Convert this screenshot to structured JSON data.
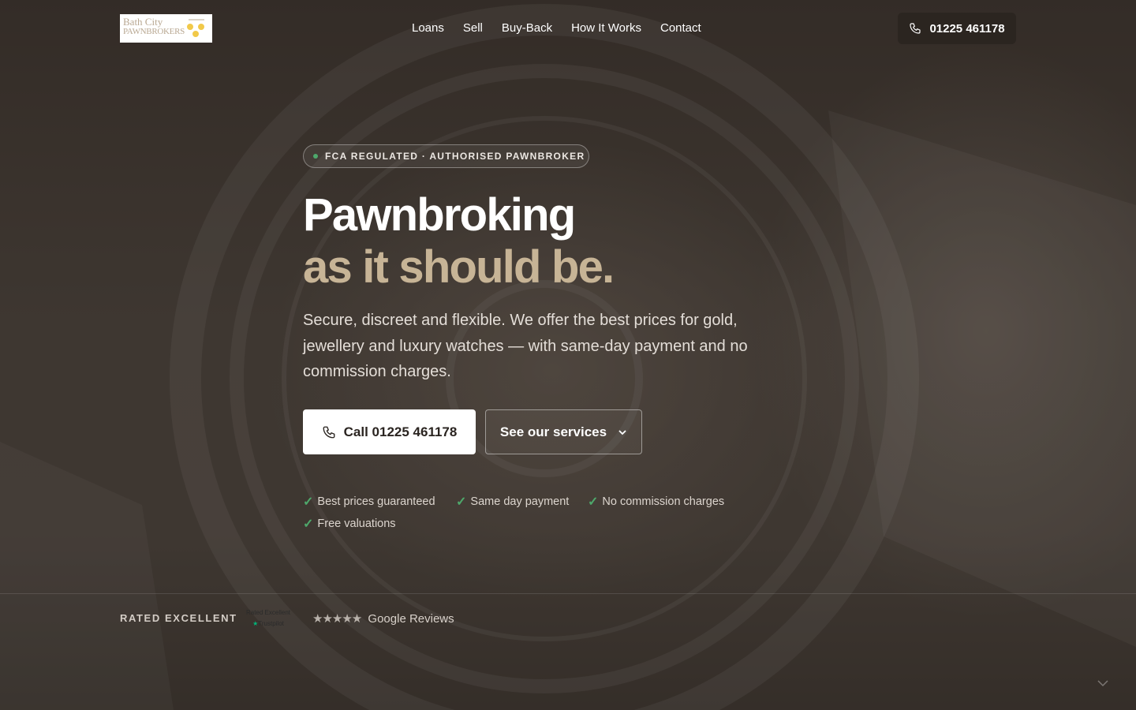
{
  "header": {
    "logo": {
      "line1": "Bath City",
      "line2": "PAWNBROKERS"
    },
    "nav": [
      "Loans",
      "Sell",
      "Buy-Back",
      "How It Works",
      "Contact"
    ],
    "phone": "01225 461178"
  },
  "hero": {
    "badge": "FCA REGULATED · AUTHORISED PAWNBROKER",
    "title_line1": "Pawnbroking",
    "title_line2": "as it should be.",
    "description": "Secure, discreet and flexible. We offer the best prices for gold, jewellery and luxury watches — with same-day payment and no commission charges.",
    "cta_primary": "Call 01225 461178",
    "cta_secondary": "See our services",
    "features": [
      "Best prices guaranteed",
      "Same day payment",
      "No commission charges",
      "Free valuations"
    ]
  },
  "rating": {
    "label": "RATED EXCELLENT",
    "trustpilot_line1": "Rated Excellent",
    "trustpilot_line2": "Trustpilot",
    "stars": "★★★★★",
    "google": "Google Reviews"
  },
  "colors": {
    "accent_gold": "#c7b496",
    "check_green": "#4ea86b",
    "header_button_bg": "#2b2520"
  },
  "icons": [
    "phone-icon",
    "chevron-down-icon",
    "check-icon",
    "star-icon",
    "trustpilot-star-icon",
    "scroll-down-icon"
  ]
}
